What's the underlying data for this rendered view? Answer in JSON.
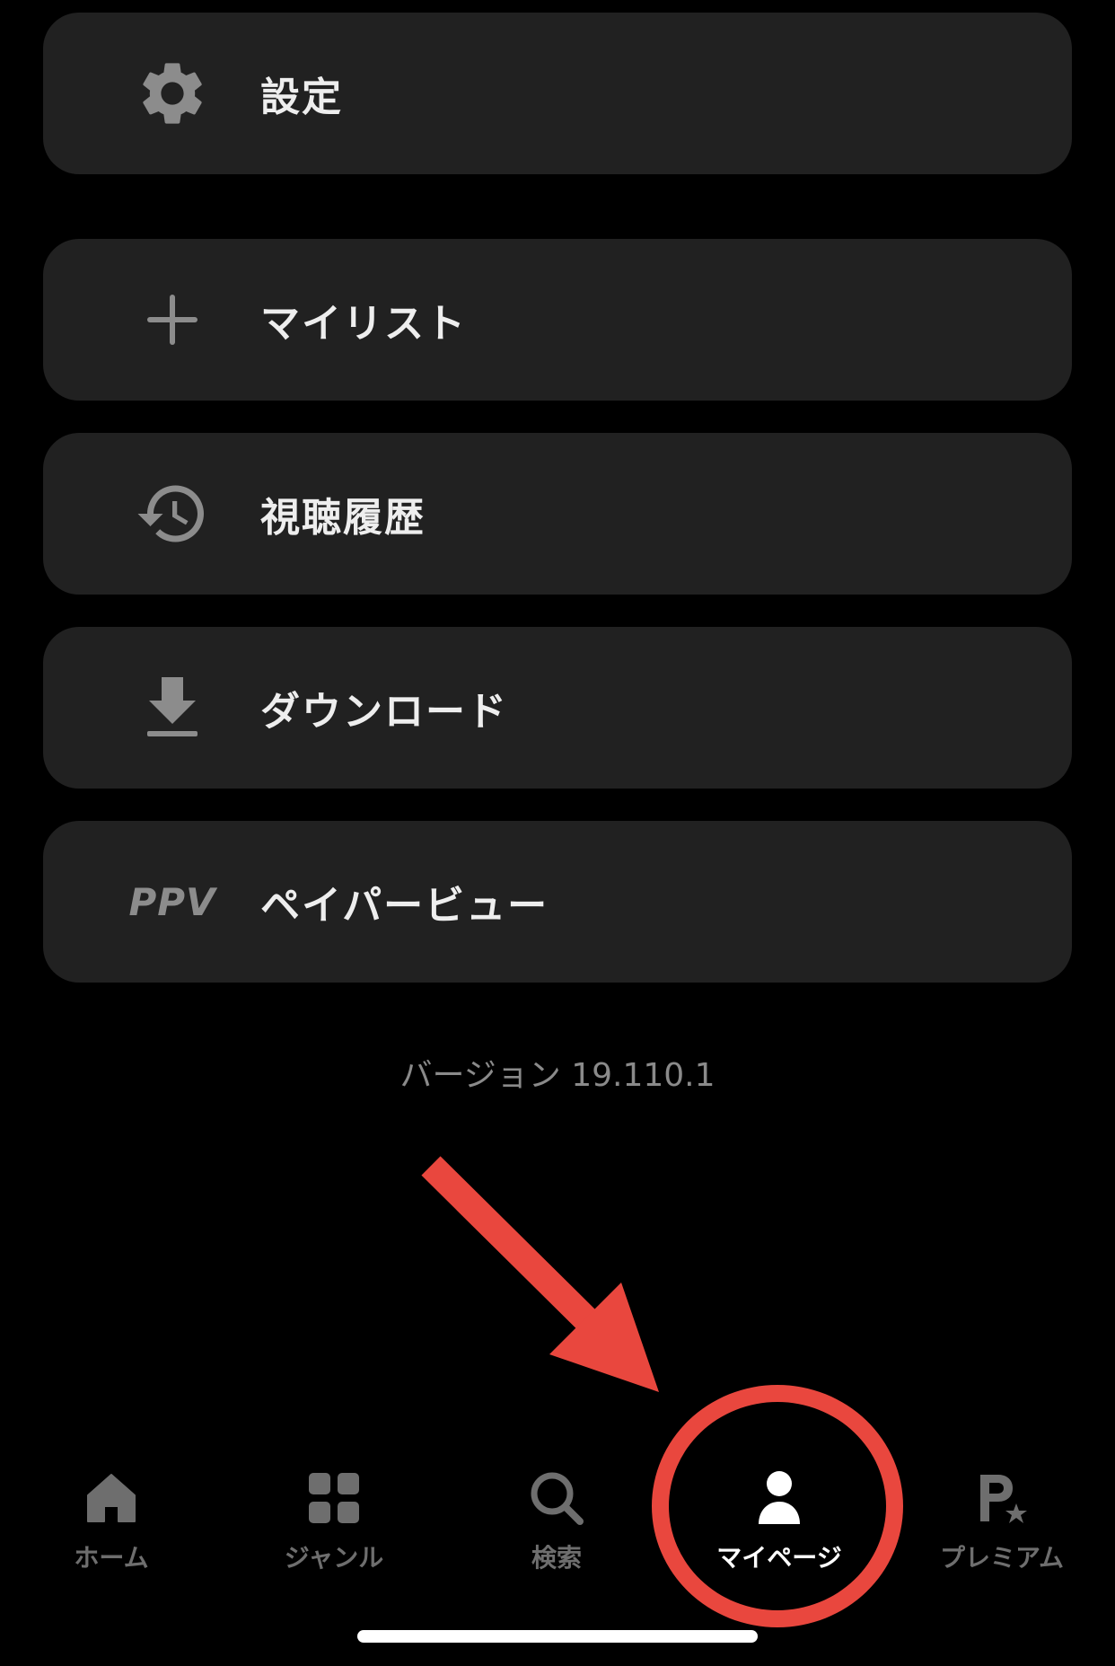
{
  "menu": {
    "settings": {
      "label": "設定",
      "icon": "gear-icon"
    },
    "mylist": {
      "label": "マイリスト",
      "icon": "plus-icon"
    },
    "history": {
      "label": "視聴履歴",
      "icon": "history-icon"
    },
    "download": {
      "label": "ダウンロード",
      "icon": "download-icon"
    },
    "ppv": {
      "label": "ペイパービュー",
      "icon_text": "PPV"
    }
  },
  "version_text": "バージョン 19.110.1",
  "tabbar": {
    "items": [
      {
        "label": "ホーム",
        "icon": "home-icon",
        "active": false
      },
      {
        "label": "ジャンル",
        "icon": "grid-icon",
        "active": false
      },
      {
        "label": "検索",
        "icon": "search-icon",
        "active": false
      },
      {
        "label": "マイページ",
        "icon": "person-icon",
        "active": true
      },
      {
        "label": "プレミアム",
        "icon": "premium-star-icon",
        "active": false
      }
    ]
  },
  "colors": {
    "background": "#000000",
    "card": "#212121",
    "icon_gray": "#8c8c8c",
    "tab_inactive": "#6e6e6e",
    "tab_active": "#ffffff",
    "annotation_red": "#e9473e"
  }
}
